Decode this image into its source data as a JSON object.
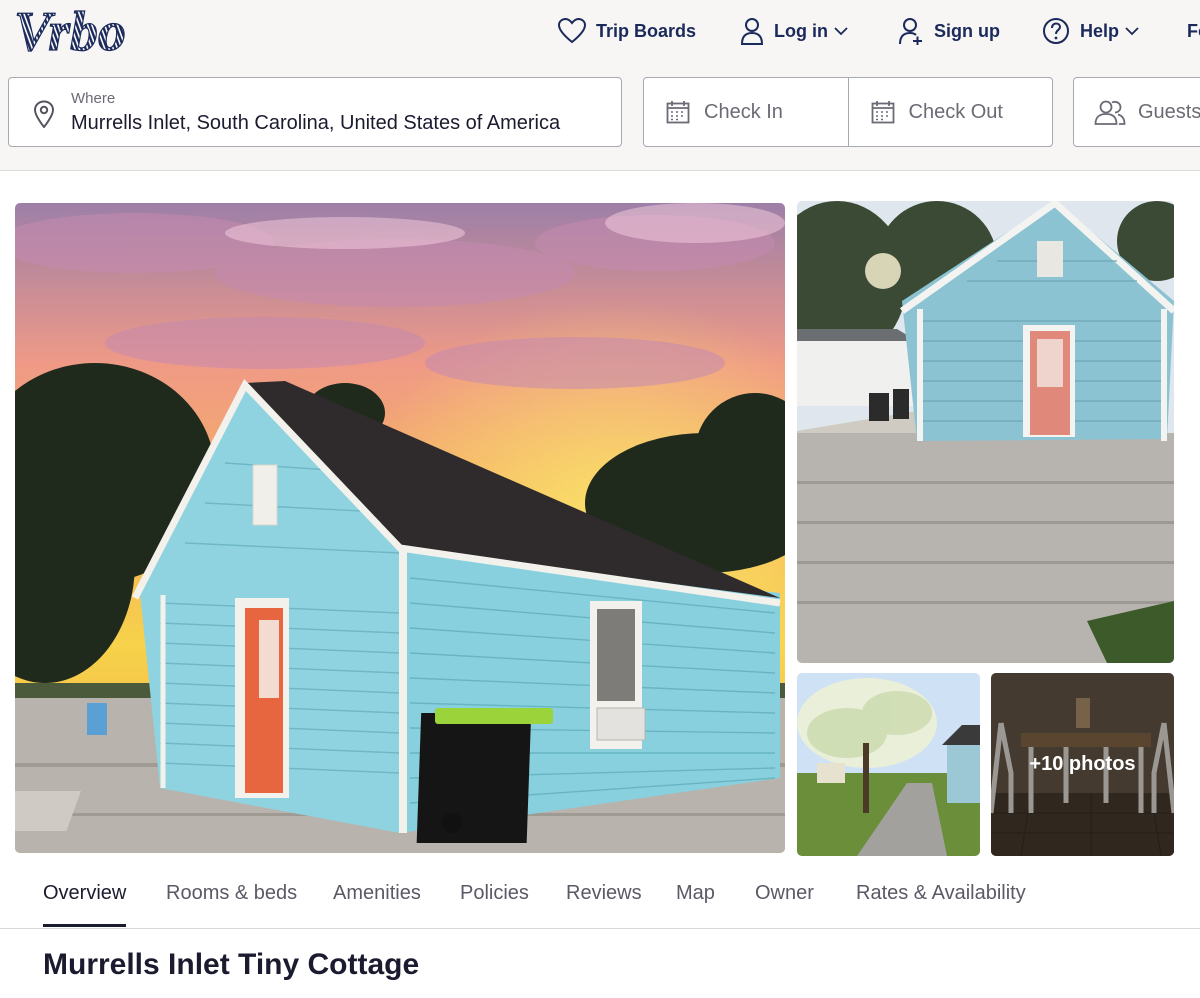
{
  "header": {
    "brand": "Vrbo",
    "nav": {
      "trip_boards": "Trip Boards",
      "log_in": "Log in",
      "sign_up": "Sign up",
      "help": "Help",
      "cutoff": "Fo"
    }
  },
  "search": {
    "where_label": "Where",
    "where_value": "Murrells Inlet, South Carolina, United States of America",
    "check_in": "Check In",
    "check_out": "Check Out",
    "guests": "Guests"
  },
  "gallery": {
    "more_photos": "+10 photos"
  },
  "tabs": [
    "Overview",
    "Rooms & beds",
    "Amenities",
    "Policies",
    "Reviews",
    "Map",
    "Owner",
    "Rates & Availability"
  ],
  "active_tab": "Overview",
  "listing": {
    "title": "Murrells Inlet Tiny Cottage"
  },
  "colors": {
    "brand_navy": "#1b2a5b",
    "cottage_blue": "#8fd3e0",
    "door_orange": "#e86a44"
  },
  "icons": [
    "heart-icon",
    "user-icon",
    "user-plus-icon",
    "help-icon",
    "chevron-down-icon",
    "location-pin-icon",
    "calendar-icon",
    "guests-icon"
  ]
}
